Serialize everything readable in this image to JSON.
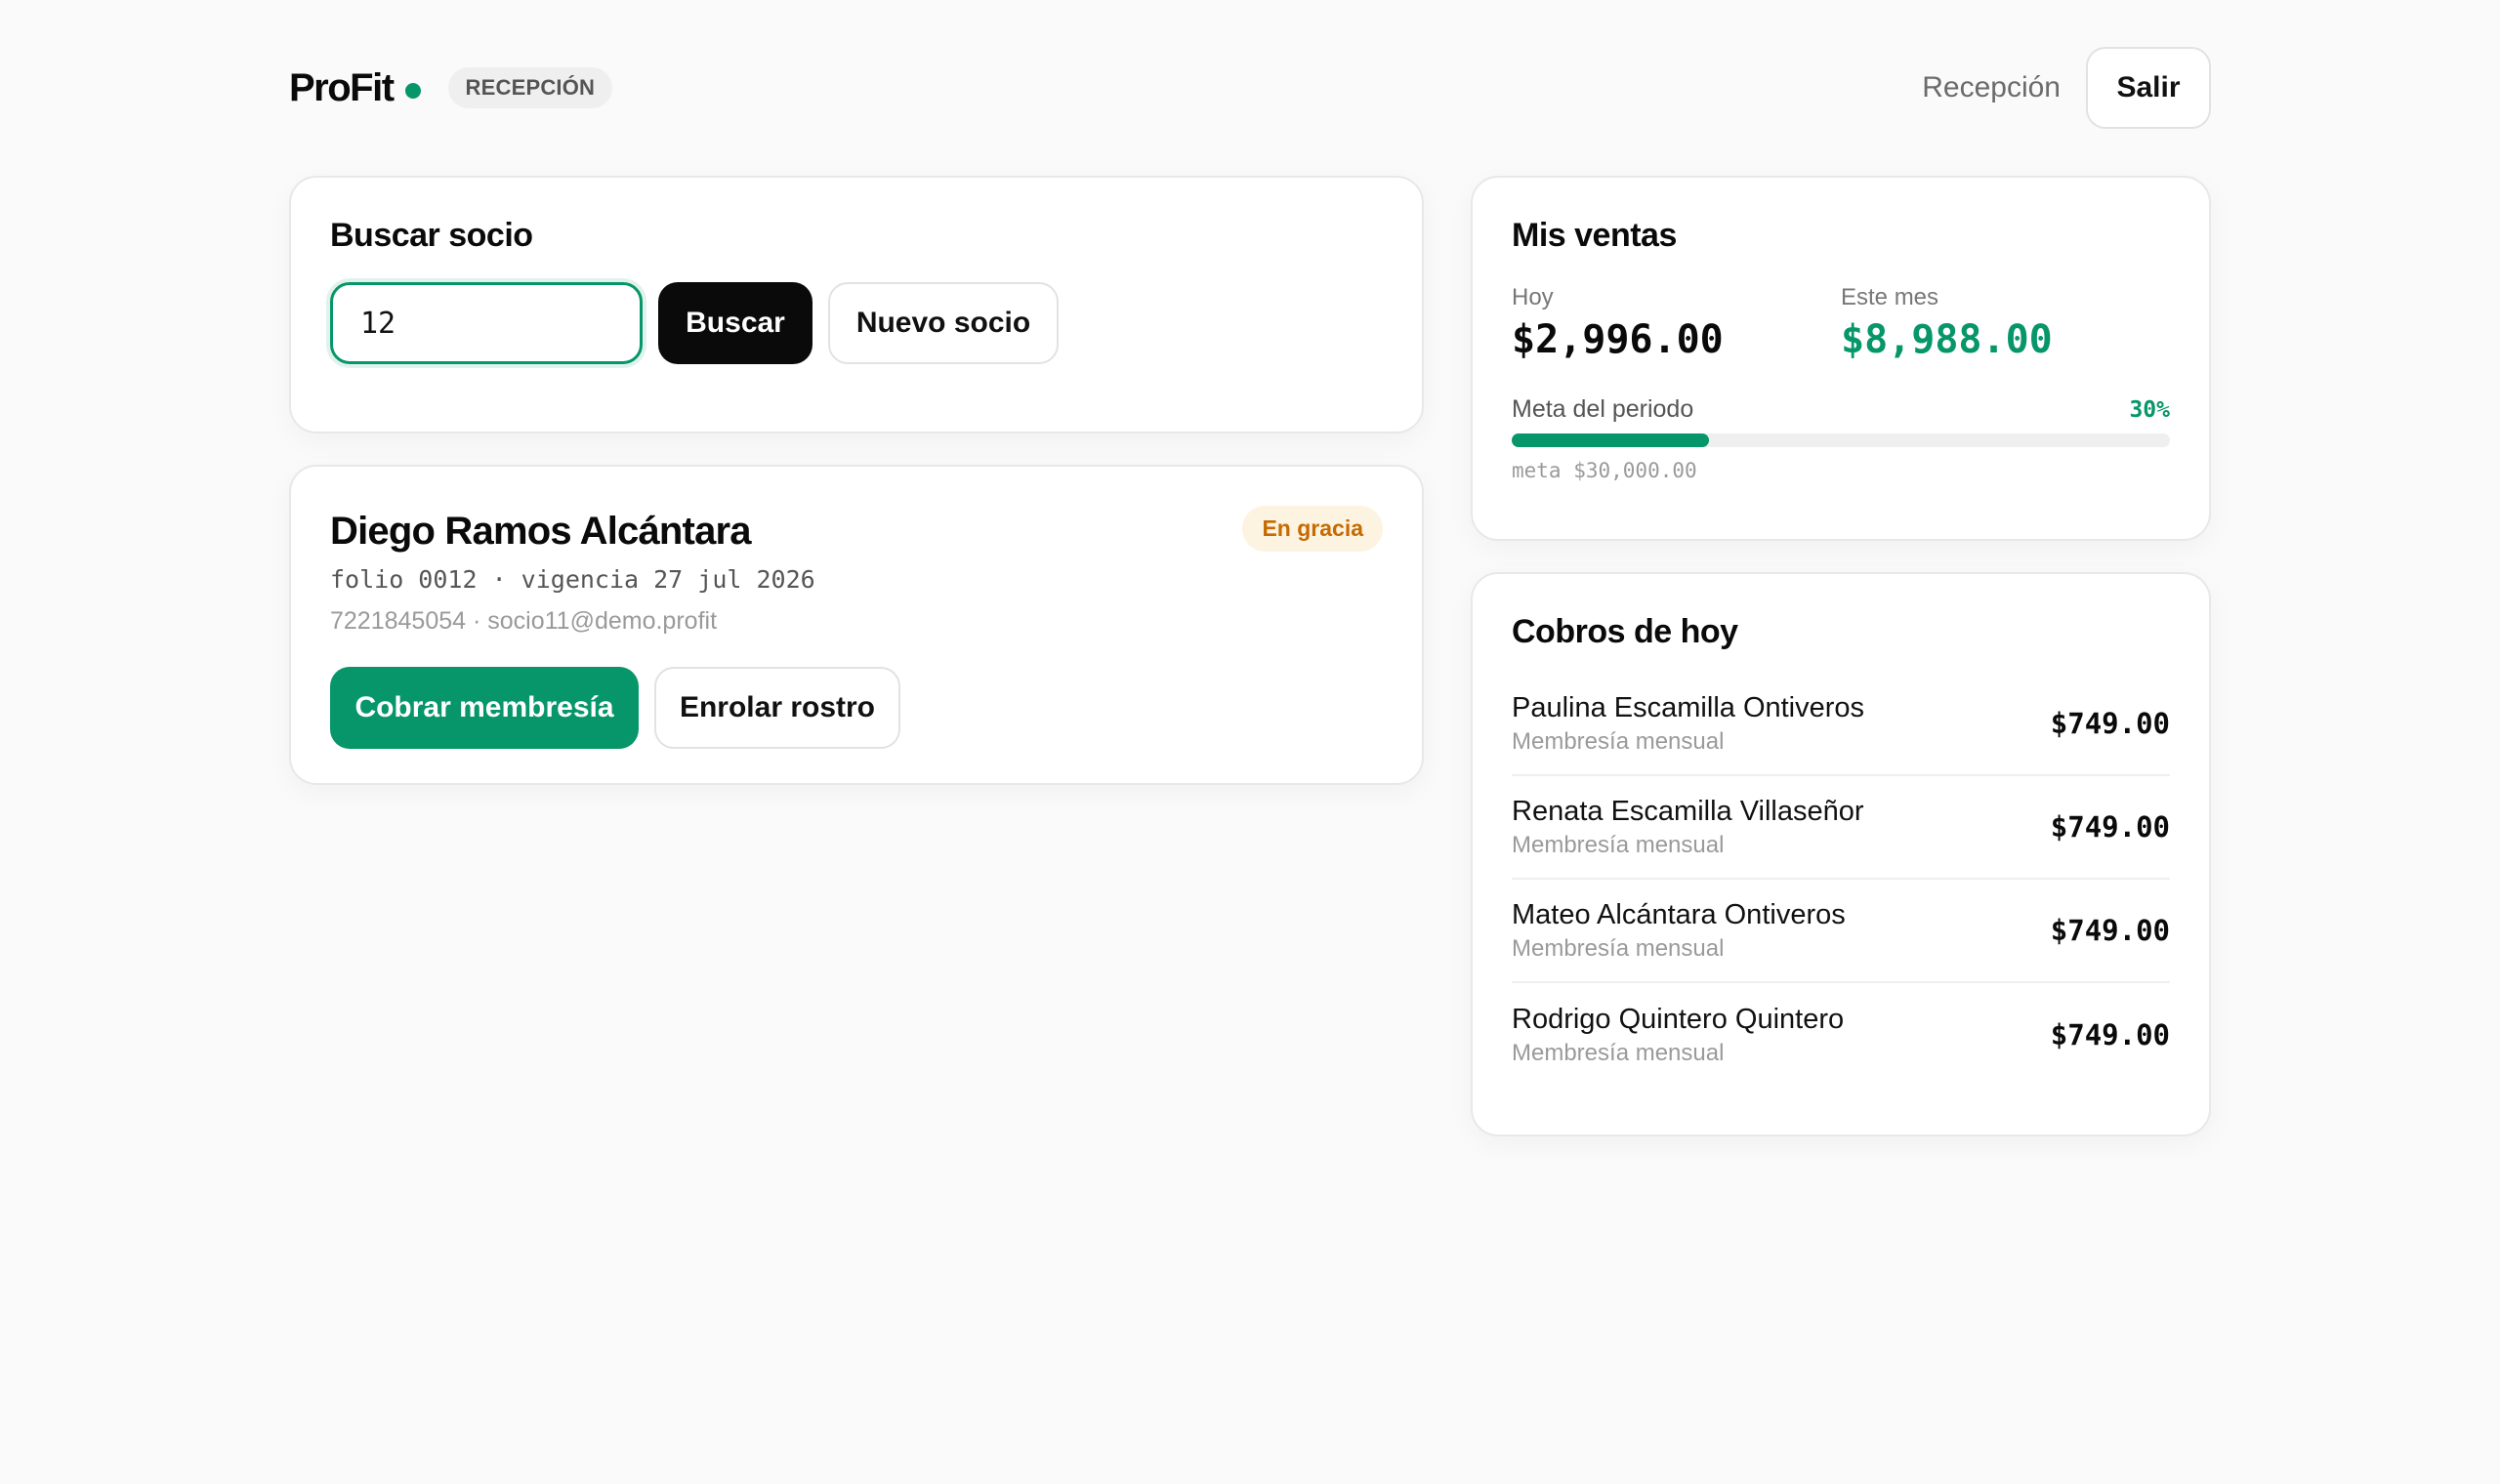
{
  "header": {
    "logo": "ProFit",
    "role_badge": "RECEPCIÓN",
    "nav_link": "Recepción",
    "logout_label": "Salir"
  },
  "search": {
    "title": "Buscar socio",
    "input_value": "12",
    "search_button": "Buscar",
    "new_member_button": "Nuevo socio"
  },
  "member": {
    "name": "Diego Ramos Alcántara",
    "meta": "folio 0012 · vigencia 27 jul 2026",
    "contact": "7221845054 · socio11@demo.profit",
    "status_badge": "En gracia",
    "charge_button": "Cobrar membresía",
    "enroll_button": "Enrolar rostro"
  },
  "sales": {
    "title": "Mis ventas",
    "today_label": "Hoy",
    "today_value": "$2,996.00",
    "month_label": "Este mes",
    "month_value": "$8,988.00",
    "goal_label": "Meta del periodo",
    "goal_percent_text": "30%",
    "goal_progress": 0.3,
    "goal_meta": "meta $30,000.00"
  },
  "payments": {
    "title": "Cobros de hoy",
    "items": [
      {
        "name": "Paulina Escamilla Ontiveros",
        "plan": "Membresía mensual",
        "amount": "$749.00"
      },
      {
        "name": "Renata Escamilla Villaseñor",
        "plan": "Membresía mensual",
        "amount": "$749.00"
      },
      {
        "name": "Mateo Alcántara Ontiveros",
        "plan": "Membresía mensual",
        "amount": "$749.00"
      },
      {
        "name": "Rodrigo Quintero Quintero",
        "plan": "Membresía mensual",
        "amount": "$749.00"
      }
    ]
  },
  "colors": {
    "accent": "#079669",
    "warning": "#c76a00",
    "dark": "#0a0a0a"
  }
}
